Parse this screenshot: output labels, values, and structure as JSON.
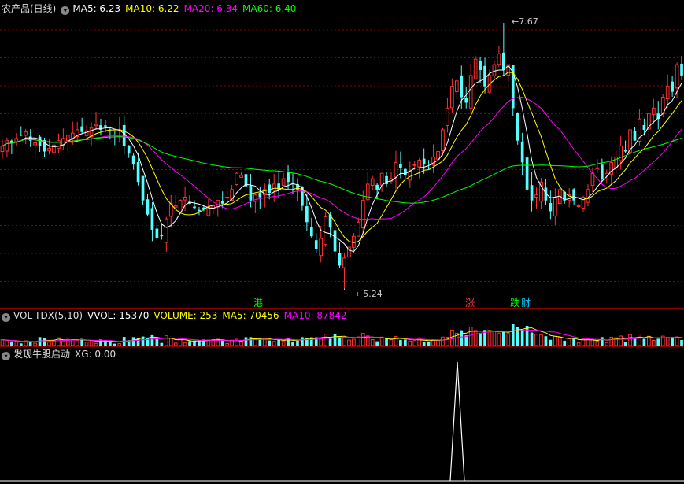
{
  "main": {
    "title": "农产品(日线)",
    "indicators": [
      {
        "label": "MA5: 6.23",
        "color": "#ffffff"
      },
      {
        "label": "MA10: 6.22",
        "color": "#ffff00"
      },
      {
        "label": "MA20: 6.34",
        "color": "#ff00ff"
      },
      {
        "label": "MA60: 6.40",
        "color": "#00ff00"
      }
    ],
    "high_label": "7.67",
    "low_label": "5.24",
    "markers": [
      {
        "text": "港",
        "color": "#00ff00"
      },
      {
        "text": "涨",
        "color": "#ff4040"
      },
      {
        "text": "跌",
        "color": "#00ff00"
      },
      {
        "text": "财",
        "color": "#00ccff"
      }
    ]
  },
  "volume": {
    "name": "VOL-TDX(5,10)",
    "indicators": [
      {
        "label": "VVOL: 15370",
        "color": "#ffffff"
      },
      {
        "label": "VOLUME: 253",
        "color": "#ffff00"
      },
      {
        "label": "MA5: 70456",
        "color": "#ffff00"
      },
      {
        "label": "MA10: 87842",
        "color": "#ff00ff"
      }
    ]
  },
  "signal": {
    "name": "发现牛股启动",
    "value_label": "XG: 0.00"
  },
  "colors": {
    "up": "#ff3232",
    "down": "#54ffff",
    "grid": "#8b0000",
    "ma5": "#ffffff",
    "ma10": "#ffff00",
    "ma20": "#ff00ff",
    "ma60": "#00ff00"
  },
  "chart_data": {
    "type": "candlestick",
    "price_range": [
      5.2,
      7.75
    ],
    "annotated_high": 7.67,
    "annotated_low": 5.24,
    "close": [
      6.55,
      6.6,
      6.58,
      6.62,
      6.65,
      6.68,
      6.6,
      6.58,
      6.55,
      6.5,
      6.53,
      6.56,
      6.6,
      6.62,
      6.65,
      6.67,
      6.7,
      6.68,
      6.69,
      6.72,
      6.75,
      6.7,
      6.73,
      6.7,
      6.65,
      6.7,
      6.55,
      6.48,
      6.38,
      6.22,
      6.05,
      5.92,
      5.78,
      5.7,
      5.72,
      5.88,
      6.02,
      6.0,
      6.05,
      6.08,
      6.02,
      5.98,
      5.95,
      5.97,
      5.99,
      6.0,
      6.05,
      6.02,
      6.08,
      6.15,
      6.3,
      6.28,
      6.18,
      6.05,
      6.1,
      6.08,
      6.15,
      6.12,
      6.2,
      6.15,
      6.25,
      6.22,
      6.2,
      6.15,
      6.0,
      5.85,
      5.72,
      5.6,
      5.7,
      5.9,
      5.8,
      5.58,
      5.45,
      5.52,
      5.62,
      5.72,
      5.85,
      6.05,
      6.2,
      6.25,
      6.15,
      6.3,
      6.2,
      6.25,
      6.4,
      6.35,
      6.28,
      6.32,
      6.38,
      6.42,
      6.38,
      6.35,
      6.45,
      6.5,
      6.7,
      6.9,
      7.1,
      7.15,
      7.0,
      6.95,
      7.2,
      7.35,
      7.25,
      7.1,
      7.2,
      7.3,
      7.4,
      7.25,
      7.3,
      6.9,
      6.6,
      6.4,
      6.15,
      6.05,
      6.1,
      6.22,
      6.05,
      5.95,
      6.08,
      6.15,
      6.05,
      6.1,
      6.05,
      6.0,
      6.08,
      6.15,
      6.3,
      6.35,
      6.25,
      6.3,
      6.4,
      6.45,
      6.55,
      6.5,
      6.7,
      6.6,
      6.8,
      6.7,
      6.85,
      6.9,
      6.8,
      7.0,
      7.1,
      7.05,
      7.3,
      7.2
    ],
    "ma5_last": 6.23,
    "ma10_last": 6.22,
    "ma20_last": 6.34,
    "ma60_last": 6.4,
    "signal_xg": 0.0
  }
}
